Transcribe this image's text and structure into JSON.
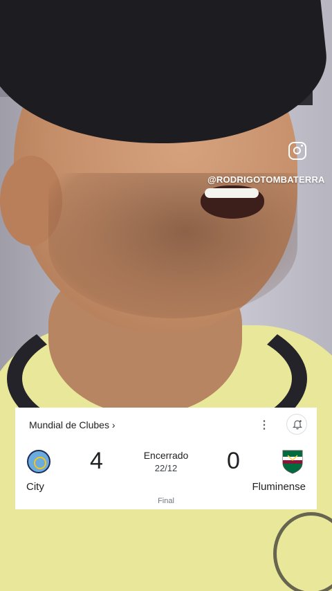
{
  "overlay": {
    "instagram_icon": "instagram-icon",
    "handle": "@RODRIGOTOMBATERRA"
  },
  "scorecard": {
    "competition": "Mundial de Clubes",
    "competition_chevron": "›",
    "more_icon": "⋮",
    "status": "Encerrado",
    "date": "22/12",
    "stage": "Final",
    "home": {
      "name": "City",
      "score": "4",
      "logo": "manchester-city-crest"
    },
    "away": {
      "name": "Fluminense",
      "score": "0",
      "logo": "fluminense-crest"
    },
    "colors": {
      "city": "#6cabdd",
      "fluminense_green": "#006b3f",
      "fluminense_red": "#8a1538"
    }
  }
}
